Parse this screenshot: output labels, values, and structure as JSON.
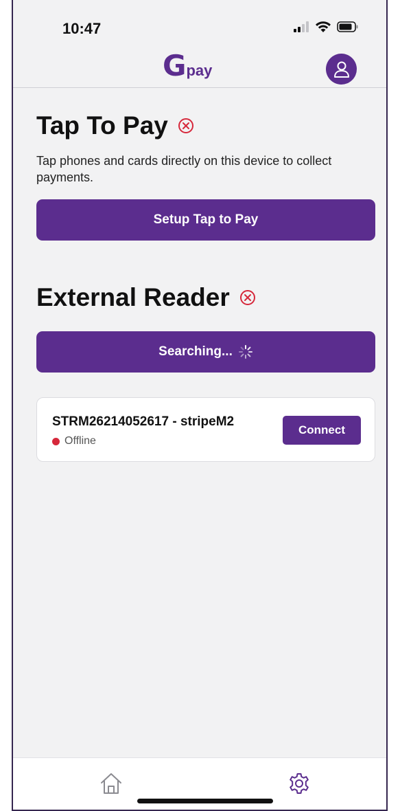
{
  "status_bar": {
    "time": "10:47"
  },
  "header": {
    "logo_mark": "G",
    "logo_text": "pay",
    "profile_icon": "person-icon",
    "brand_color": "#5b2d8e"
  },
  "tap_to_pay": {
    "title": "Tap To Pay",
    "status_icon": "error-circle-x-icon",
    "description": "Tap phones and cards directly on this device to collect payments.",
    "button_label": "Setup Tap to Pay"
  },
  "external_reader": {
    "title": "External Reader",
    "status_icon": "error-circle-x-icon",
    "search_button_label": "Searching...",
    "readers": [
      {
        "name": "STRM26214052617 - stripeM2",
        "status": "Offline",
        "status_color": "#d6283b",
        "connect_label": "Connect"
      }
    ]
  },
  "tab_bar": {
    "tabs": [
      {
        "icon": "home-icon"
      },
      {
        "icon": "gear-icon",
        "active": true
      }
    ]
  }
}
